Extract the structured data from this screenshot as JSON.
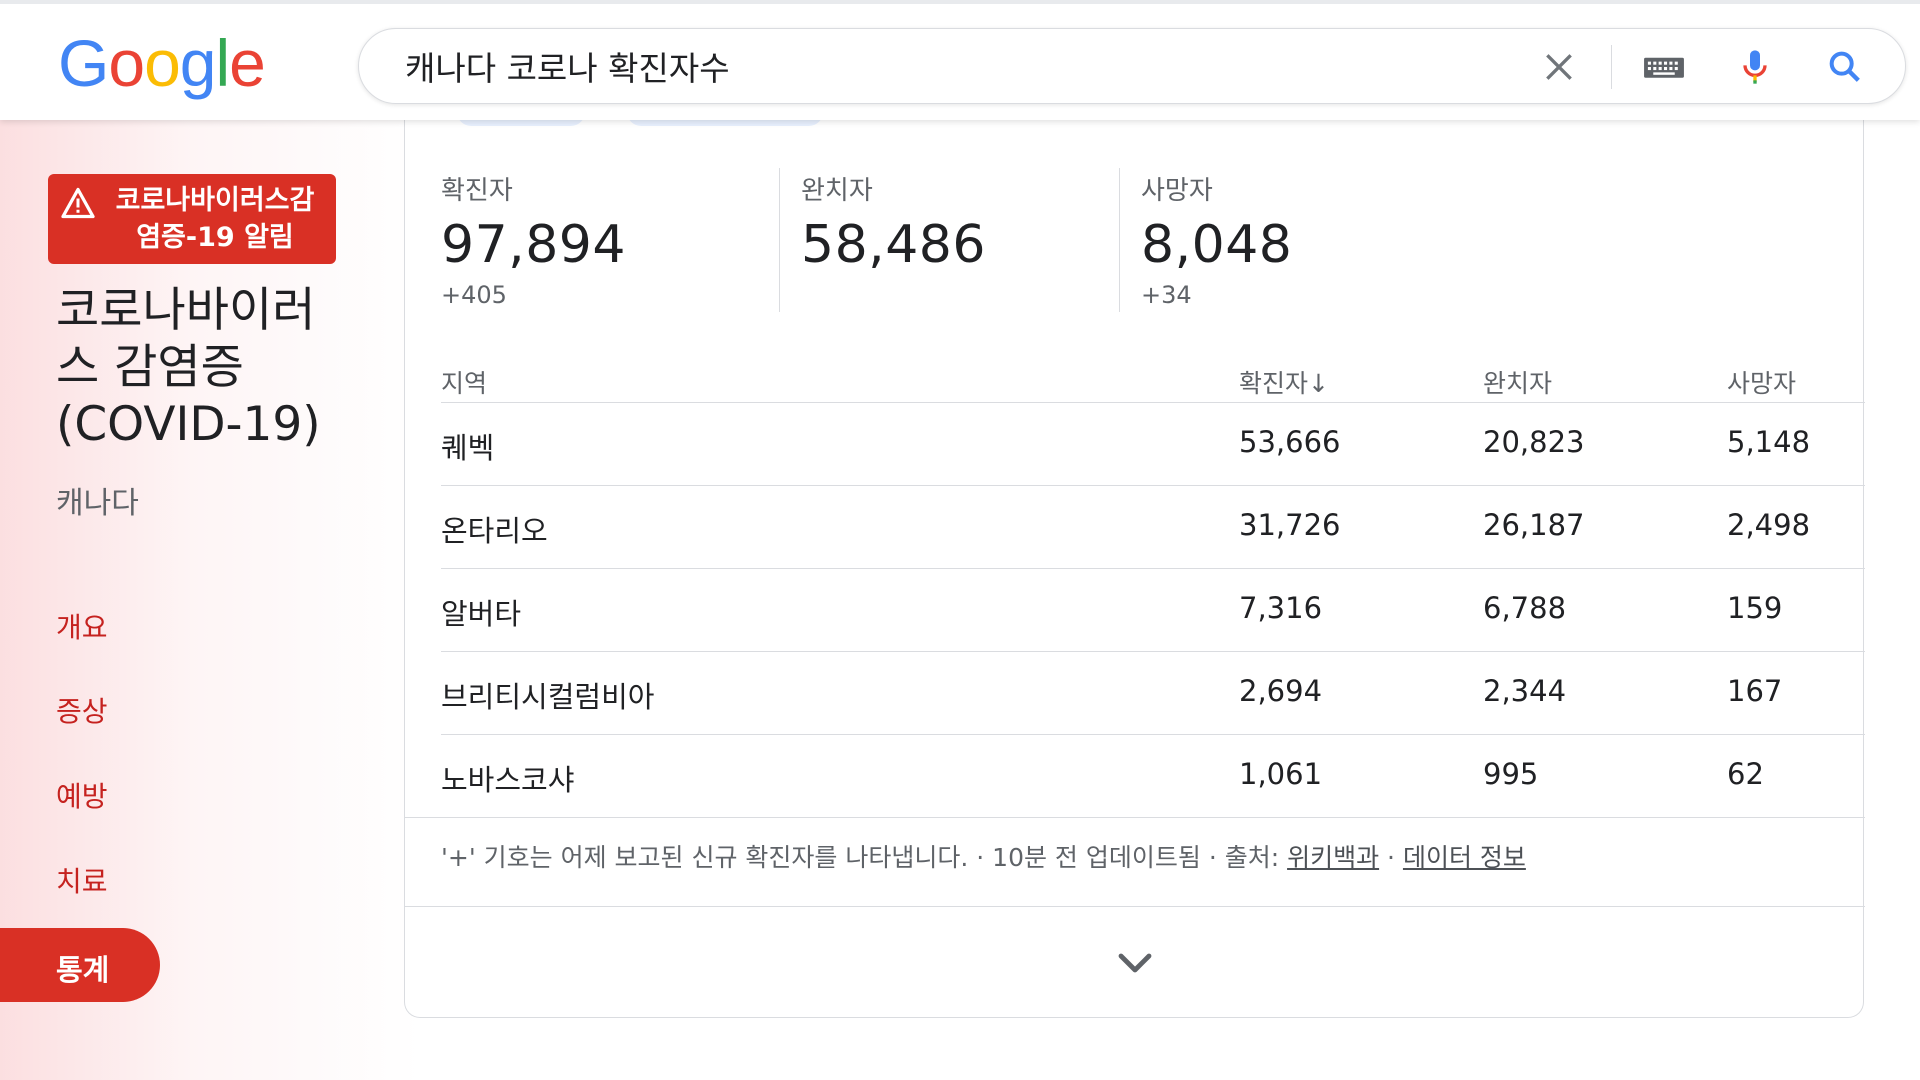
{
  "header": {
    "logo": [
      "G",
      "o",
      "o",
      "g",
      "l",
      "e"
    ],
    "logo_colors": [
      "#4285F4",
      "#EA4335",
      "#FBBC05",
      "#4285F4",
      "#34A853",
      "#EA4335"
    ],
    "search_query": "캐나다 코로나 확진자수"
  },
  "sidebar": {
    "alert_label": "코로나바이러스감염증-19 알림",
    "topic_title": "코로나바이러스 감염증 (COVID-19)",
    "region": "캐나다",
    "nav": [
      {
        "label": "개요"
      },
      {
        "label": "증상"
      },
      {
        "label": "예방"
      },
      {
        "label": "치료"
      }
    ],
    "active_nav": "통계"
  },
  "stats": [
    {
      "label": "확진자",
      "value": "97,894",
      "delta": "+405"
    },
    {
      "label": "완치자",
      "value": "58,486",
      "delta": ""
    },
    {
      "label": "사망자",
      "value": "8,048",
      "delta": "+34"
    }
  ],
  "table": {
    "headers": [
      "지역",
      "확진자↓",
      "완치자",
      "사망자"
    ],
    "rows": [
      [
        "퀘벡",
        "53,666",
        "20,823",
        "5,148"
      ],
      [
        "온타리오",
        "31,726",
        "26,187",
        "2,498"
      ],
      [
        "알버타",
        "7,316",
        "6,788",
        "159"
      ],
      [
        "브리티시컬럼비아",
        "2,694",
        "2,344",
        "167"
      ],
      [
        "노바스코샤",
        "1,061",
        "995",
        "62"
      ]
    ]
  },
  "footnote": {
    "text": "'+' 기호는 어제 보고된 신규 확진자를 나타냅니다. · 10분 전 업데이트됨  ·  출처: ",
    "source_link": "위키백과",
    "separator": " · ",
    "data_link": "데이터 정보"
  },
  "colors": {
    "accent_red": "#d93025",
    "nav_text_red": "#c5221f",
    "mic_blue": "#4285F4",
    "mic_red": "#EA4335"
  },
  "icons": {
    "clear": "close-icon",
    "keyboard": "keyboard-icon",
    "mic": "mic-icon",
    "search": "search-icon",
    "alert": "warning-icon",
    "expand": "chevron-down-icon"
  }
}
